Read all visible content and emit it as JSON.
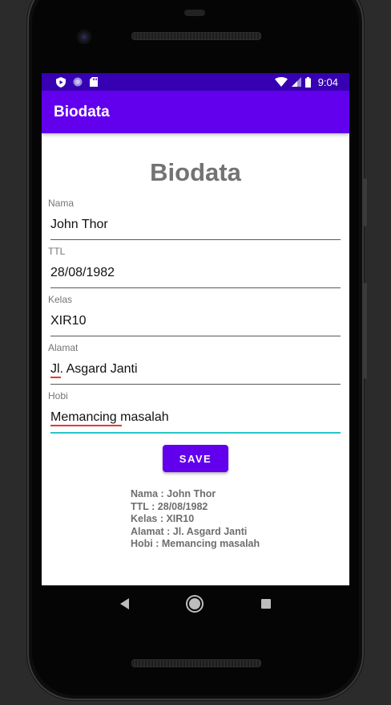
{
  "status_bar": {
    "time": "9:04",
    "icons": [
      "shield-play-icon",
      "circle-icon",
      "sd-card-icon",
      "wifi-icon",
      "signal-icon",
      "battery-icon"
    ]
  },
  "app_bar": {
    "title": "Biodata"
  },
  "page": {
    "heading": "Biodata"
  },
  "form": {
    "nama": {
      "label": "Nama",
      "value": "John Thor"
    },
    "ttl": {
      "label": "TTL",
      "value": "28/08/1982"
    },
    "kelas": {
      "label": "Kelas",
      "value": "XIR10"
    },
    "alamat": {
      "label": "Alamat",
      "value": "Jl. Asgard Janti"
    },
    "hobi": {
      "label": "Hobi",
      "value": "Memancing masalah"
    }
  },
  "save_button": {
    "label": "SAVE"
  },
  "output": {
    "nama": "Nama : John Thor",
    "ttl": "TTL : 28/08/1982",
    "kelas": "Kelas : XIR10",
    "alamat": "Alamat : Jl. Asgard Janti",
    "hobi": "Hobi : Memancing masalah"
  },
  "nav_bar": {
    "icons": [
      "back-icon",
      "home-icon",
      "recents-icon"
    ]
  },
  "colors": {
    "primary": "#6200ee",
    "primary_dark": "#3700b3",
    "focus_underline": "#26c6c6",
    "spellcheck": "#e53935"
  }
}
